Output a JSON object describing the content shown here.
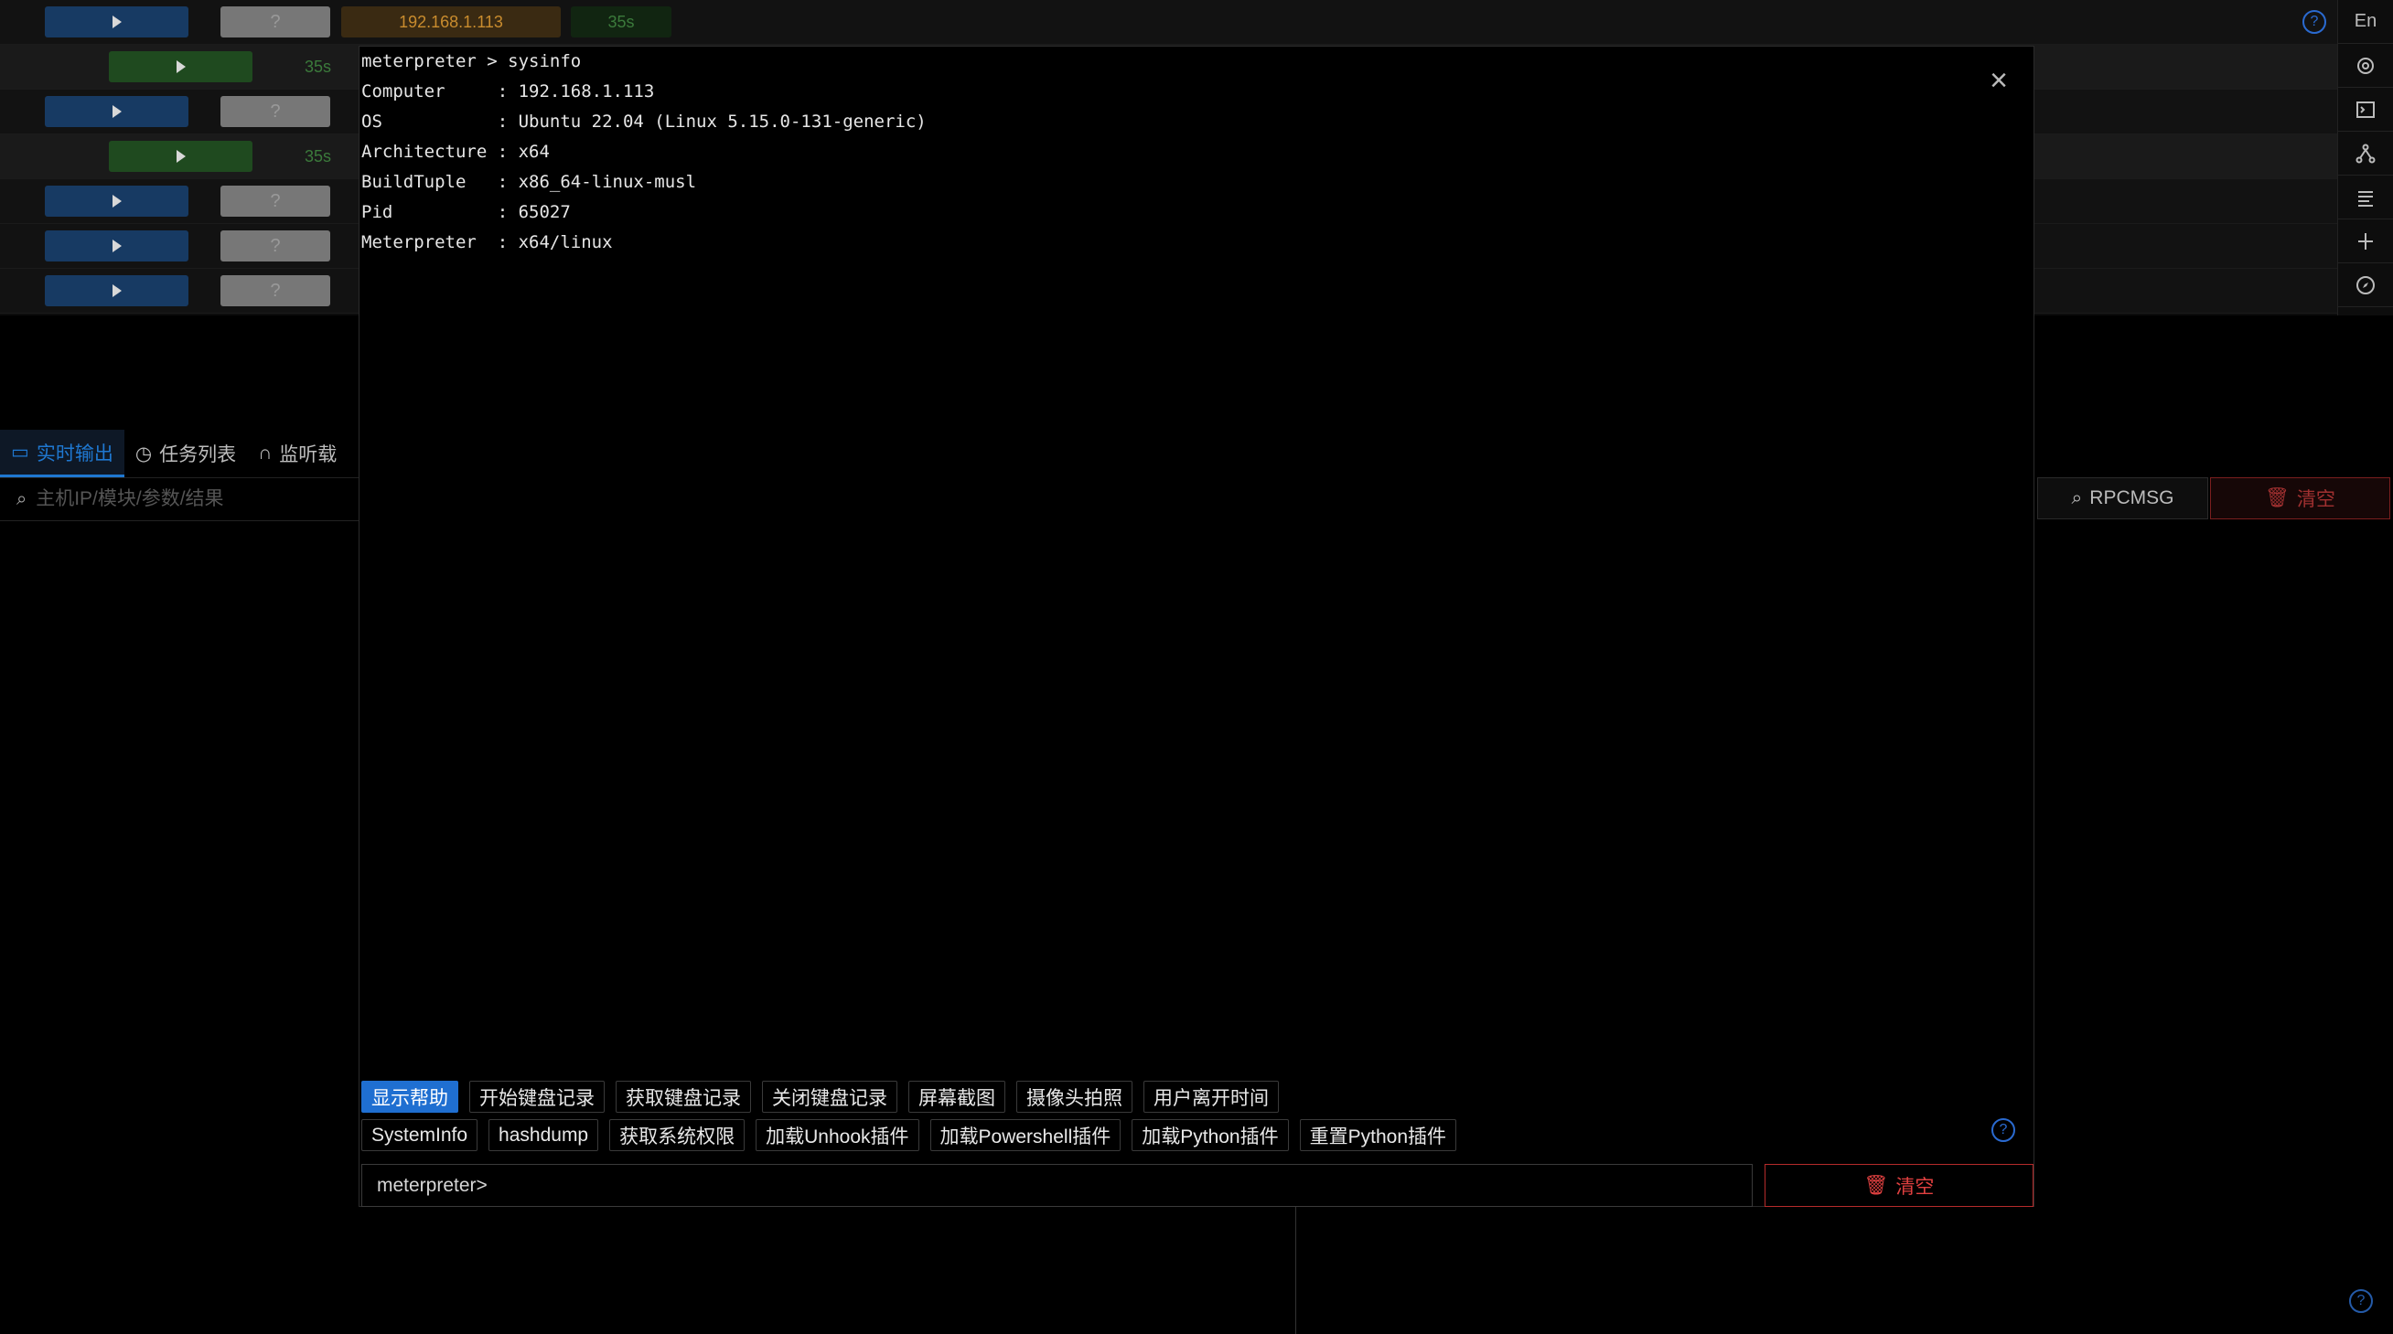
{
  "background": {
    "rows": [
      {
        "ip": "192.168.1.113",
        "time": "35s",
        "question": "?"
      },
      {
        "time": "35s"
      },
      {
        "question": "?"
      },
      {
        "time": "35s"
      },
      {
        "question": "?"
      },
      {
        "question": "?"
      },
      {
        "question": "?"
      }
    ],
    "lang_label": "En",
    "tabs": [
      "实时输出",
      "任务列表",
      "监听载"
    ],
    "search_placeholder": "主机IP/模块/参数/结果",
    "rpc_label": "RPCMSG",
    "clear_label": "清空"
  },
  "modal": {
    "terminal": {
      "prompt_line": "meterpreter > sysinfo",
      "lines": [
        "Computer     : 192.168.1.113",
        "OS           : Ubuntu 22.04 (Linux 5.15.0-131-generic)",
        "Architecture : x64",
        "BuildTuple   : x86_64-linux-musl",
        "Pid          : 65027",
        "Meterpreter  : x64/linux"
      ]
    },
    "buttons_row1": [
      "显示帮助",
      "开始键盘记录",
      "获取键盘记录",
      "关闭键盘记录",
      "屏幕截图",
      "摄像头拍照",
      "用户离开时间"
    ],
    "buttons_row2": [
      "SystemInfo",
      "hashdump",
      "获取系统权限",
      "加载Unhook插件",
      "加载Powershell插件",
      "加载Python插件",
      "重置Python插件"
    ],
    "input_placeholder": "meterpreter>",
    "clear_label": "清空"
  },
  "icons": {
    "rail": [
      "language-icon",
      "openai-icon",
      "terminal-icon",
      "network-icon",
      "list-icon",
      "split-icon",
      "compass-icon"
    ]
  },
  "colors": {
    "primary": "#1f6fd1",
    "danger": "#e04040"
  }
}
